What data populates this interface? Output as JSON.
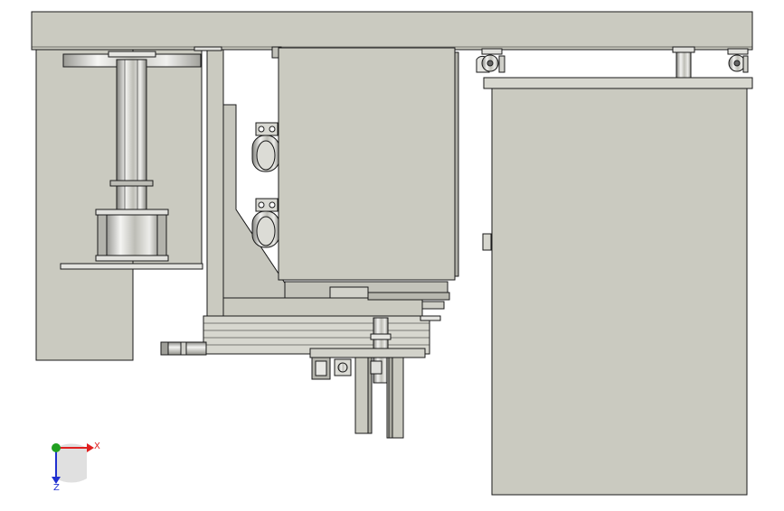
{
  "colors": {
    "background": "#ffffff",
    "part_fill": "#cacac0",
    "part_fill_light": "#d7d7cf",
    "part_fill_dark": "#a9a9a0",
    "metal_light": "#f2f2f0",
    "metal_dark": "#8e8e8a",
    "edge": "#1a1a1a",
    "axis_x": "#e02020",
    "axis_y": "#20a020",
    "axis_z": "#2030d0"
  },
  "triad": {
    "x_label": "X",
    "z_label": "Z"
  }
}
